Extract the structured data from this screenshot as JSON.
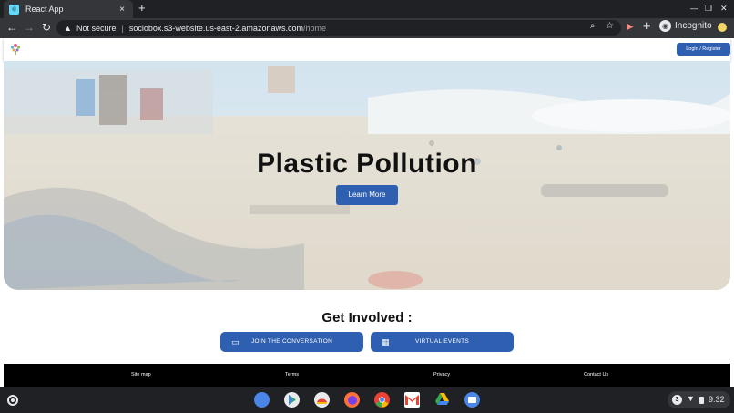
{
  "browser": {
    "tab_title": "React App",
    "tab_close": "×",
    "new_tab": "+",
    "security_label": "Not secure",
    "url_host": "sociobox.s3-website.us-east-2.amazonaws.com",
    "url_path": "/home",
    "incognito_label": "Incognito"
  },
  "navbar": {
    "login_label": "Login / Register"
  },
  "hero": {
    "title": "Plastic Pollution",
    "button_label": "Learn More"
  },
  "get_involved": {
    "title": "Get Involved :",
    "buttons": [
      {
        "label": "JOIN THE CONVERSATION",
        "icon": "chat-icon"
      },
      {
        "label": "VIRTUAL EVENTS",
        "icon": "calendar-icon"
      }
    ]
  },
  "footer": {
    "links": [
      "Site map",
      "Terms",
      "Privacy",
      "Contact Us"
    ]
  },
  "shelf": {
    "apps": [
      "settings",
      "play-store",
      "chrome-web-store",
      "firefox",
      "chrome",
      "gmail",
      "google-drive",
      "files"
    ],
    "notification_count": "3",
    "time": "9:32"
  },
  "colors": {
    "accent": "#2f5fb0",
    "footer_bg": "#000000",
    "chrome_dark": "#202124",
    "chrome_toolbar": "#35363a"
  }
}
